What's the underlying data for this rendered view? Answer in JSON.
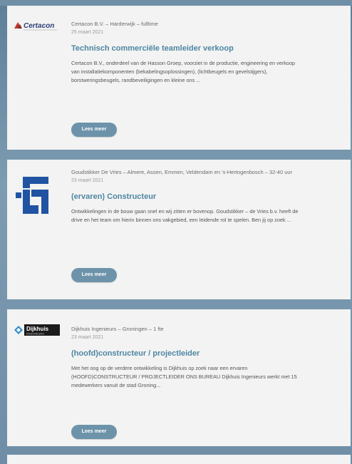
{
  "jobs": [
    {
      "logo_text": "Certacon",
      "meta": "Certacon B.V. – Harderwijk – fulltime",
      "date": "25 maart 2021",
      "title": "Technisch commerciële teamleider verkoop",
      "description": "Certacon B.V., onderdeel van de Hasson Groep, voorziet in de productie, engineering en verkoop van installatiekomponenten (bekabelingsoplossingen), (lichtbeugels en gevelstijgers), borstweringsbeugels, randbeveiligingen en kleine ons ...",
      "button": "Lees meer"
    },
    {
      "meta": "Goudstikker De Vries – Almere, Assen, Emmen, Veldendam en 's-Hertogenbosch – 32-40 uur",
      "date": "23 maart 2021",
      "title": "(ervaren) Constructeur",
      "description": "Ontwikkelingen in de bouw gaan snel en wij zitten er bovenop. Goudstikker – de Vries b.v. heeft de drive en het team om hierin binnen ons vakgebied, een leidende rol te spelen. Ben jij op zoek ...",
      "button": "Lees meer"
    },
    {
      "logo_text": "Dijkhuis",
      "logo_subtext": "INGENIEURS",
      "meta": "Dijkhuis Ingenieurs – Groningen – 1 fte",
      "date": "23 maart 2021",
      "title": "(hoofd)constructeur / projectleider",
      "description": "Met het oog op de verdere ontwikkeling is Dijkhuis op zoek naar een ervaren (HOOFD)CONSTRUCTEUR / PROJECTLEIDER ONS BUREAU Dijkhuis Ingenieurs werkt met 15 medewerkers vanuit de stad Groning...",
      "button": "Lees meer"
    }
  ],
  "colors": {
    "title": "#4f86a3",
    "button": "#6d93aa",
    "card": "#f2f3f2",
    "background": "#6f8ea6"
  }
}
